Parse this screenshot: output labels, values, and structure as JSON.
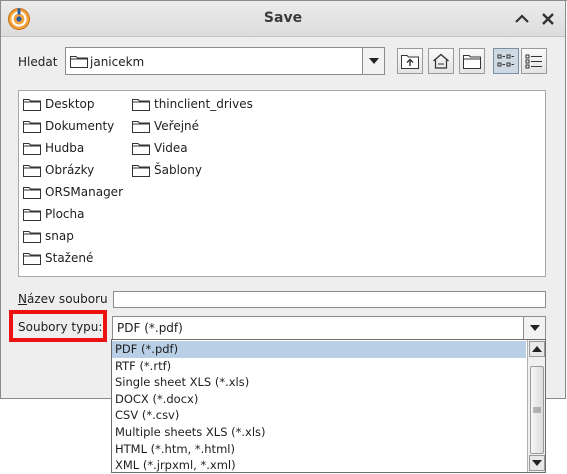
{
  "window": {
    "title": "Save"
  },
  "look_in": {
    "label": "Hledat",
    "value": "janicekm"
  },
  "toolbar": {
    "buttons": [
      {
        "icon": "up-one-level-icon"
      },
      {
        "icon": "home-icon"
      },
      {
        "icon": "new-folder-icon"
      },
      {
        "icon": "list-view-icon",
        "active": true
      },
      {
        "icon": "details-view-icon"
      }
    ]
  },
  "files": [
    "Desktop",
    "Dokumenty",
    "Hudba",
    "Obrázky",
    "ORSManager",
    "Plocha",
    "snap",
    "Stažené",
    "thinclient_drives",
    "Veřejné",
    "Videa",
    "Šablony"
  ],
  "file_name": {
    "label": "Název souboru",
    "value": ""
  },
  "file_type": {
    "label": "Soubory typu:",
    "value": "PDF (*.pdf)",
    "options": [
      "PDF (*.pdf)",
      "RTF (*.rtf)",
      "Single sheet XLS (*.xls)",
      "DOCX (*.docx)",
      "CSV (*.csv)",
      "Multiple sheets XLS (*.xls)",
      "HTML (*.htm, *.html)",
      "XML (*.jrpxml, *.xml)"
    ],
    "selected_index": 0
  },
  "colors": {
    "highlight": "#ee1111",
    "selection": "#b8cfe5",
    "active_button": "#cfd9e4"
  }
}
